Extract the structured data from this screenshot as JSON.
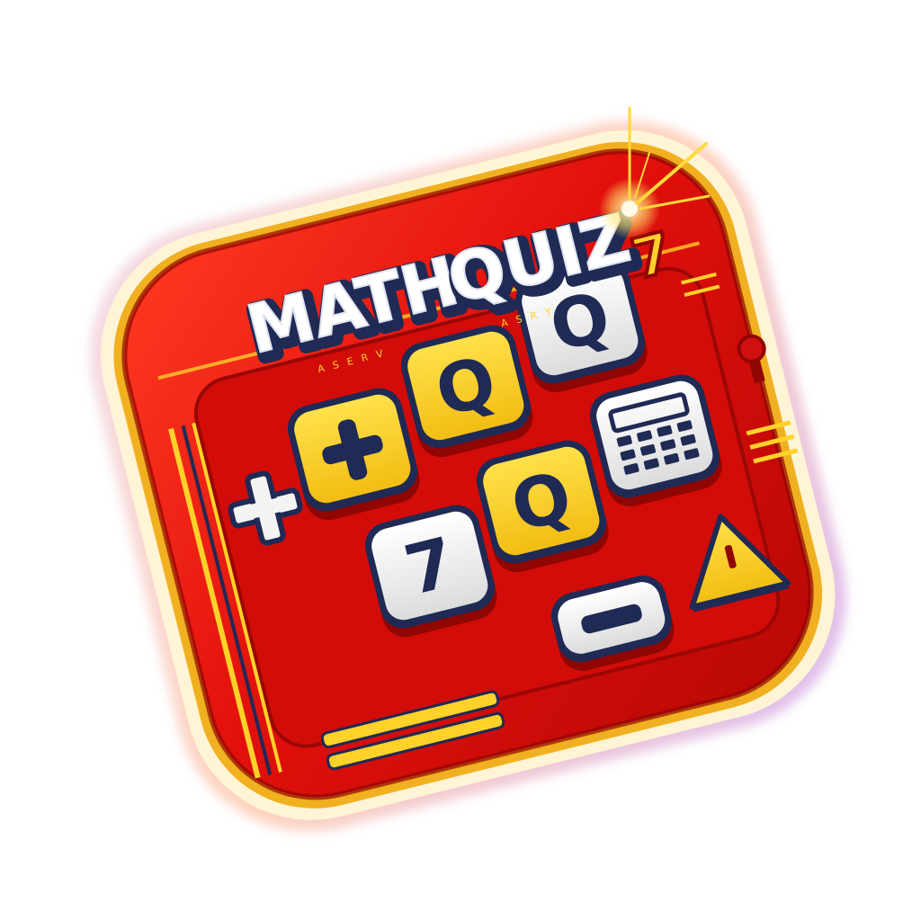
{
  "app_icon": {
    "title": "MATH QUIZ",
    "title_word_1": "MATH",
    "title_word_2": "QUIZ",
    "tiny_decor_1": "A S E R V",
    "tiny_decor_2": "A S R Y",
    "side_digit": "7",
    "colors": {
      "body_red": "#e2100c",
      "dark_red": "#8f0603",
      "yellow": "#f7d21b",
      "navy": "#1f2a55",
      "white_key": "#f3f3f1",
      "glow": "#ffe46a"
    },
    "keys": [
      {
        "id": "plus",
        "label": "+",
        "face": "yellow",
        "icon": "plus-icon"
      },
      {
        "id": "q-1",
        "label": "Q",
        "face": "yellow",
        "icon": "letter-q-icon"
      },
      {
        "id": "q-2",
        "label": "Q",
        "face": "white",
        "icon": "letter-q-icon"
      },
      {
        "id": "calculator",
        "label": "",
        "face": "white",
        "icon": "calculator-icon"
      },
      {
        "id": "q-3",
        "label": "Q",
        "face": "yellow",
        "icon": "letter-q-icon"
      },
      {
        "id": "seven",
        "label": "7",
        "face": "white",
        "icon": "digit-seven-icon"
      },
      {
        "id": "minus",
        "label": "",
        "face": "white",
        "icon": "minus-icon"
      },
      {
        "id": "triangle",
        "label": "",
        "face": "yellow",
        "icon": "warning-triangle-icon"
      }
    ],
    "side_plus_icon": "plus-icon",
    "sparkle_icon": "sparkle-icon"
  }
}
